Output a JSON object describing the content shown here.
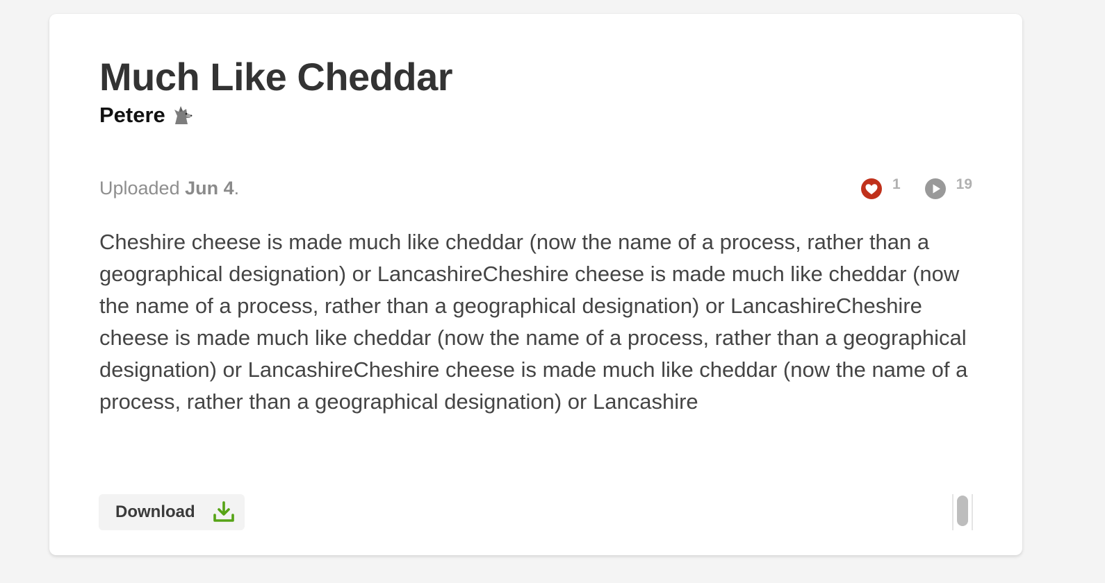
{
  "track": {
    "title": "Much Like Cheddar",
    "author": "Petere",
    "author_icon": "wolf-icon",
    "uploaded_prefix": "Uploaded ",
    "uploaded_date": "Jun 4",
    "uploaded_suffix": ".",
    "description": "Cheshire cheese is made much like cheddar (now the name of a process, rather than a geographical designation) or LancashireCheshire cheese is made much like cheddar (now the name of a process, rather than a geographical designation) or LancashireCheshire cheese is made much like cheddar (now the name of a process, rather than a geographical designation) or LancashireCheshire cheese is made much like cheddar (now the name of a process, rather than a geographical designation) or Lancashire"
  },
  "stats": {
    "likes": "1",
    "like_icon": "heart-icon",
    "plays": "19",
    "play_icon": "play-icon"
  },
  "actions": {
    "download_label": "Download",
    "download_icon": "download-icon"
  },
  "colors": {
    "like": "#c0311b",
    "play": "#999999",
    "download": "#56a316",
    "background": "#f4f4f4",
    "card": "#ffffff"
  }
}
